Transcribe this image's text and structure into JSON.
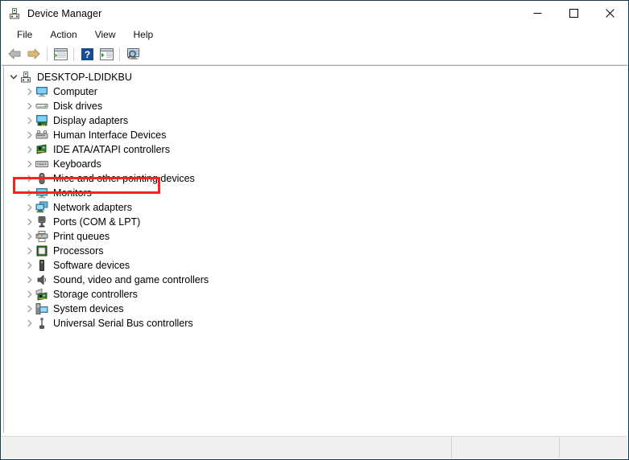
{
  "window": {
    "title": "Device Manager",
    "app_icon": "device-manager-icon",
    "controls": [
      {
        "name": "minimize-button",
        "glyph": "minimize-icon"
      },
      {
        "name": "maximize-button",
        "glyph": "maximize-icon"
      },
      {
        "name": "close-button",
        "glyph": "close-icon"
      }
    ]
  },
  "menubar": {
    "items": [
      {
        "label": "File"
      },
      {
        "label": "Action"
      },
      {
        "label": "View"
      },
      {
        "label": "Help"
      }
    ]
  },
  "toolbar": {
    "buttons": [
      {
        "name": "back-button",
        "icon": "back-arrow-icon"
      },
      {
        "name": "forward-button",
        "icon": "forward-arrow-icon"
      },
      {
        "name": "show-hide-console-tree-button",
        "icon": "console-tree-icon"
      },
      {
        "name": "help-button",
        "icon": "question-mark-icon"
      },
      {
        "name": "properties-button",
        "icon": "properties-window-icon"
      },
      {
        "name": "scan-for-hardware-changes-button",
        "icon": "monitor-magnifier-icon"
      }
    ]
  },
  "tree": {
    "root": {
      "label": "DESKTOP-LDIDKBU",
      "icon": "computer-node-icon",
      "expanded": true
    },
    "nodes": [
      {
        "label": "Computer",
        "icon": "monitor-icon"
      },
      {
        "label": "Disk drives",
        "icon": "disk-drive-icon"
      },
      {
        "label": "Display adapters",
        "icon": "display-adapter-icon",
        "highlighted": true
      },
      {
        "label": "Human Interface Devices",
        "icon": "hid-icon"
      },
      {
        "label": "IDE ATA/ATAPI controllers",
        "icon": "ide-controller-icon"
      },
      {
        "label": "Keyboards",
        "icon": "keyboard-icon"
      },
      {
        "label": "Mice and other pointing devices",
        "icon": "mouse-icon"
      },
      {
        "label": "Monitors",
        "icon": "monitor-icon"
      },
      {
        "label": "Network adapters",
        "icon": "network-adapter-icon"
      },
      {
        "label": "Ports (COM & LPT)",
        "icon": "port-icon"
      },
      {
        "label": "Print queues",
        "icon": "printer-icon"
      },
      {
        "label": "Processors",
        "icon": "processor-icon"
      },
      {
        "label": "Software devices",
        "icon": "software-device-icon"
      },
      {
        "label": "Sound, video and game controllers",
        "icon": "speaker-icon"
      },
      {
        "label": "Storage controllers",
        "icon": "storage-controller-icon"
      },
      {
        "label": "System devices",
        "icon": "system-device-icon"
      },
      {
        "label": "Universal Serial Bus controllers",
        "icon": "usb-icon"
      }
    ]
  },
  "statusbar": {
    "panes": [
      {
        "name": "status-pane-main",
        "text": ""
      },
      {
        "name": "status-pane-secondary",
        "text": ""
      },
      {
        "name": "status-pane-tertiary",
        "text": ""
      }
    ]
  },
  "annotation": {
    "highlight_color": "#fb2222",
    "highlight_target": "Display adapters"
  }
}
